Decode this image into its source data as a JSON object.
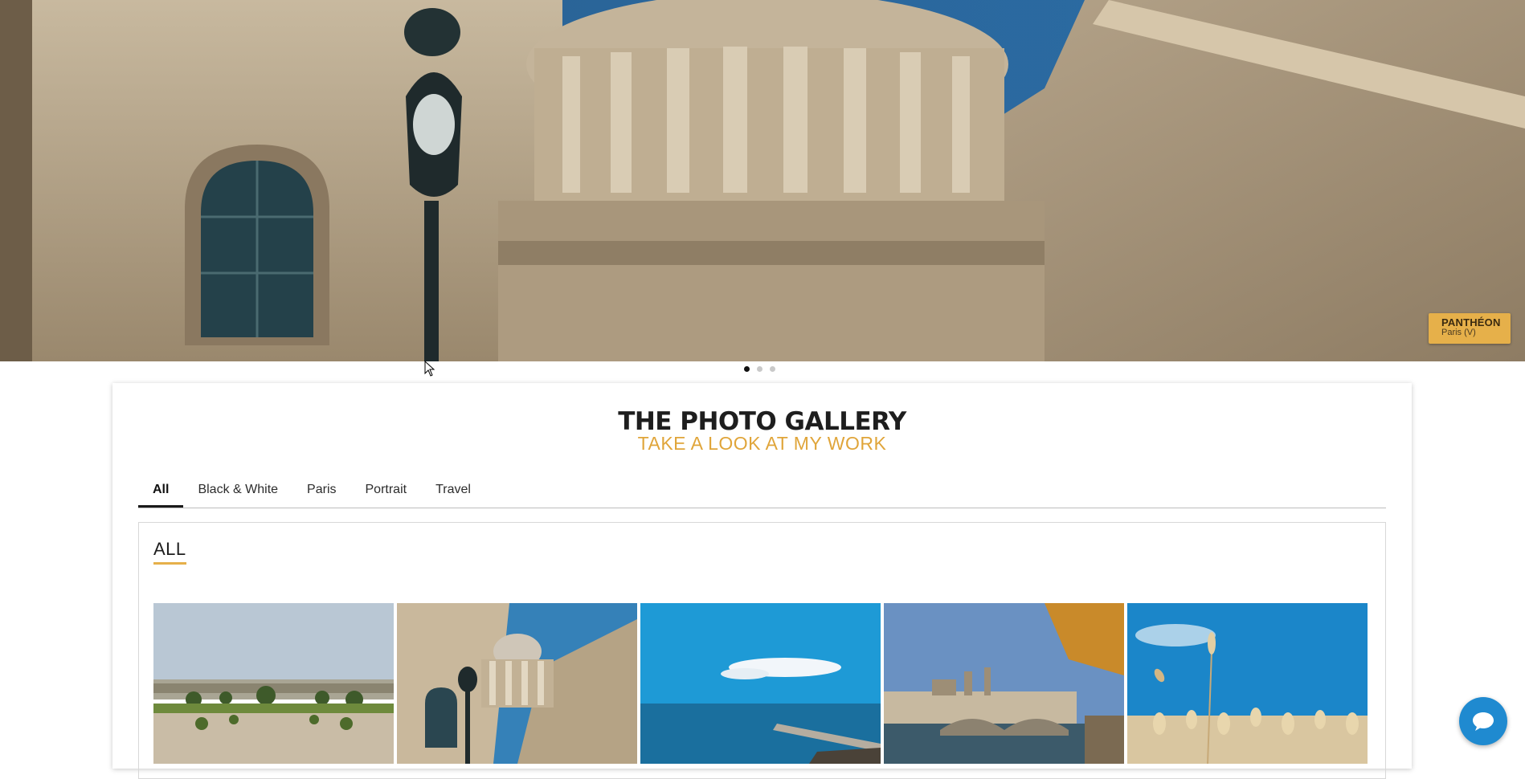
{
  "hero": {
    "caption_title": "PANTHÉON",
    "caption_subtitle": "Paris (V)",
    "slides": 3,
    "active_slide": 1
  },
  "gallery": {
    "title": "THE PHOTO GALLERY",
    "subtitle": "TAKE A LOOK AT MY WORK",
    "tabs": [
      {
        "label": "All",
        "active": true
      },
      {
        "label": "Black & White",
        "active": false
      },
      {
        "label": "Paris",
        "active": false
      },
      {
        "label": "Portrait",
        "active": false
      },
      {
        "label": "Travel",
        "active": false
      }
    ],
    "panel_heading": "ALL"
  },
  "colors": {
    "accent": "#e6b04a",
    "subtitle": "#e0a53a",
    "chat": "#1f8ad0"
  },
  "icons": {
    "chat": "chat-bubble-icon",
    "cursor": "mouse-cursor-icon"
  }
}
